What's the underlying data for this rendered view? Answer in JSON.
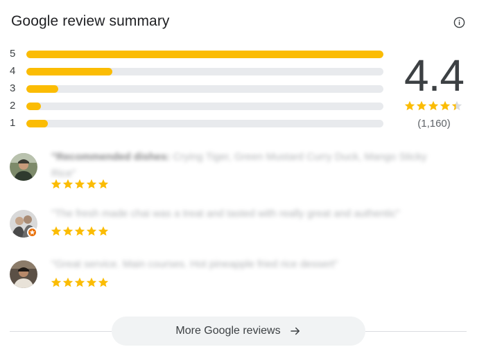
{
  "panel": {
    "title": "Google review summary",
    "info_icon": "info-icon"
  },
  "distribution": [
    {
      "label": "5",
      "fraction": 1.0
    },
    {
      "label": "4",
      "fraction": 0.24
    },
    {
      "label": "3",
      "fraction": 0.09
    },
    {
      "label": "2",
      "fraction": 0.04
    },
    {
      "label": "1",
      "fraction": 0.06
    }
  ],
  "rating": {
    "score": "4.4",
    "stars_value": 4.4,
    "count": "(1,160)"
  },
  "reviews": [
    {
      "text_bold": "\"Recommended dishes:",
      "text": " Crying Tiger, Green Mustard Curry Duck, Mango Sticky Rice\"",
      "stars": 5
    },
    {
      "text_bold": "",
      "text": "\"The fresh made chai was a treat and tasted with really great and authentic\"",
      "stars": 5
    },
    {
      "text_bold": "",
      "text": "\"Great service. Main courses. Hot pineapple fried rice dessert\"",
      "stars": 5
    }
  ],
  "more_button": {
    "label": "More Google reviews",
    "icon": "arrow-right-icon"
  },
  "colors": {
    "star": "#fbbc04",
    "track": "#e8eaed",
    "badge": "#e8710a"
  }
}
